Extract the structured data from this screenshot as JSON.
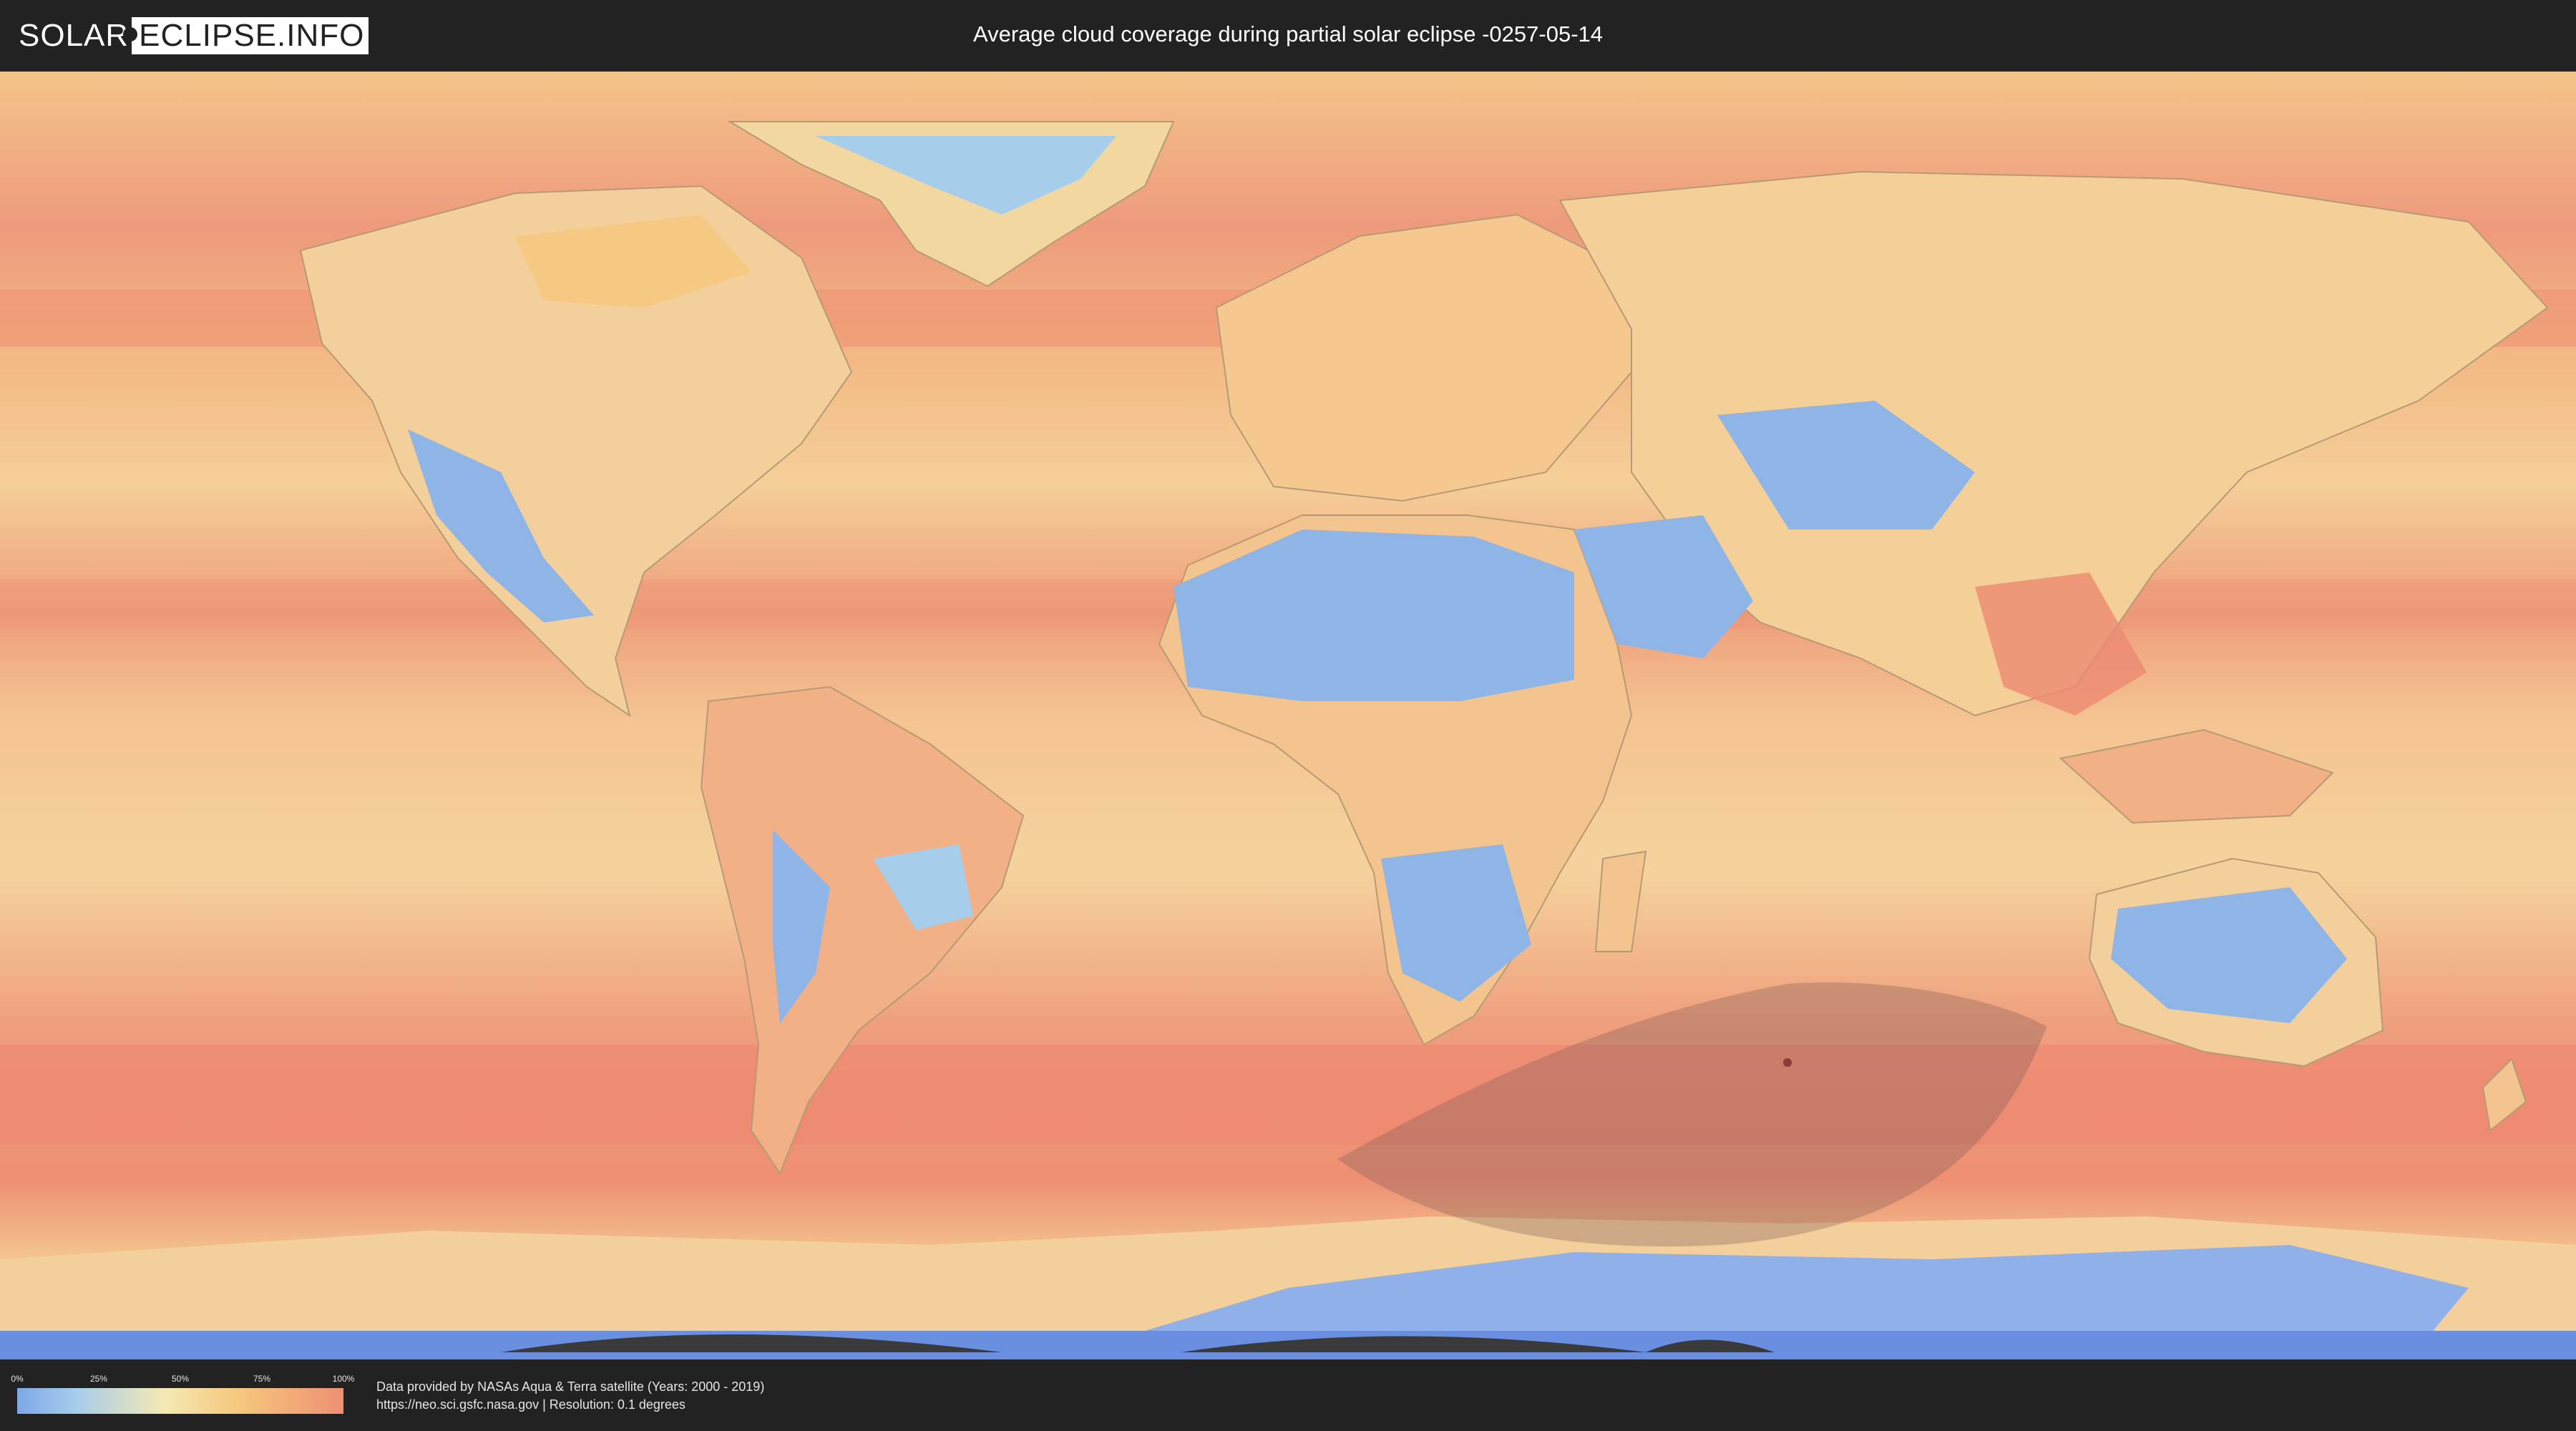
{
  "header": {
    "logo_left": "SOLAR",
    "logo_right": "ECLIPSE.INFO",
    "title": "Average cloud coverage during partial solar eclipse -0257-05-14"
  },
  "legend": {
    "ticks": [
      "0%",
      "25%",
      "50%",
      "75%",
      "100%"
    ],
    "colors": [
      "#7ea7e8",
      "#a6cdea",
      "#f4e9b3",
      "#f6c77d",
      "#ee8f73"
    ]
  },
  "credits": {
    "line1": "Data provided by NASAs Aqua & Terra satellite (Years: 2000 - 2019)",
    "line2": "https://neo.sci.gsfc.nasa.gov | Resolution: 0.1 degrees"
  },
  "map": {
    "ocean_color": "#ec9a78",
    "land_clear_color": "#8fb4e6",
    "land_mid_color": "#f3d7a0",
    "eclipse_shadow_color": "#7d5a55",
    "antarctica_color": "#8fb0e8"
  }
}
